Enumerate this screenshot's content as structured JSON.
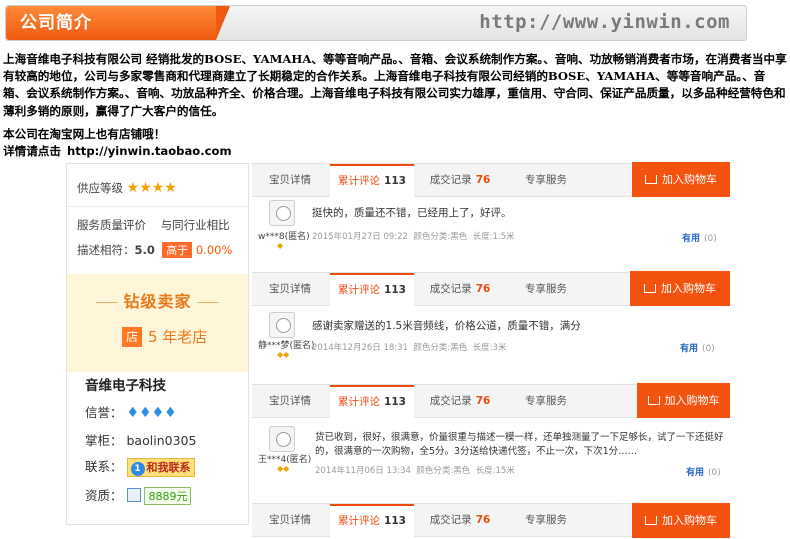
{
  "banner": {
    "title": "公司简介",
    "url": "http://www.yinwin.com"
  },
  "intro": {
    "paragraph": "上海音维电子科技有限公司 经销批发的BOSE、YAMAHA、等等音响产品。、音箱、会议系统制作方案。、音响、功放畅销消费者市场，在消费者当中享有较高的地位，公司与多家零售商和代理商建立了长期稳定的合作关系。上海音维电子科技有限公司经销的BOSE、YAMAHA、等等音响产品。、音箱、会议系统制作方案。、音响、功放品种齐全、价格合理。上海音维电子科技有限公司实力雄厚，重信用、守合同、保证产品质量，以多品种经营特色和薄利多销的原则，赢得了广大客户的信任。",
    "taobao_line": "本公司在淘宝网上也有店铺哦！",
    "details_label": "详情请点击",
    "details_link": "http://yinwin.taobao.com"
  },
  "shop": {
    "supply_label": "供应等级",
    "stars": "★★★★",
    "service_label": "服务质量评价",
    "compare_label": "与同行业相比",
    "desc_label": "描述相符：",
    "desc_score": "5.0",
    "desc_tag": "高于",
    "desc_pct": "0.00%",
    "diamond_title": "钻级卖家",
    "years_icon": "店",
    "years_text": "5 年老店",
    "name": "音维电子科技",
    "credit_label": "信誉：",
    "credit_gems": "♦♦♦♦",
    "owner_label": "掌柜：",
    "owner_value": "baolin0305",
    "contact_label": "联系：",
    "contact_button": "和我联系",
    "contact_icon": "ww-icon",
    "qual_label": "资质：",
    "qual_num": "8889元"
  },
  "tabs": {
    "details": "宝贝详情",
    "reviews": "累计评论",
    "reviews_count": "113",
    "deals": "成交记录",
    "deals_count": "76",
    "service": "专享服务",
    "cart": "加入购物车"
  },
  "reviews": [
    {
      "user": "w***8(匿名)",
      "text": "挺快的，质量还不错，已经用上了，好评。",
      "date": "2015年01月27日 09:22",
      "spec": "颜色分类:黑色",
      "length": "长度:1.5米",
      "useful": "有用",
      "useful_count": "(0)"
    },
    {
      "user": "静***梦(匿名)",
      "text": "感谢卖家赠送的1.5米音频线，价格公道，质量不错，满分",
      "date": "2014年12月26日 18:31",
      "spec": "颜色分类:黑色",
      "length": "长度:3米",
      "useful": "有用",
      "useful_count": "(0)"
    },
    {
      "user": "王***4(匿名)",
      "text": "货已收到，很好，很满意，价量很重与描述一模一样，还单独测量了一下足够长，试了一下还挺好的，很满意的一次购物，全5分。3分送给快递代签，不止一次，下次1分……",
      "date": "2014年11月06日 13:34",
      "spec": "颜色分类:黑色",
      "length": "长度:15米",
      "useful": "有用",
      "useful_count": "(0)"
    }
  ]
}
